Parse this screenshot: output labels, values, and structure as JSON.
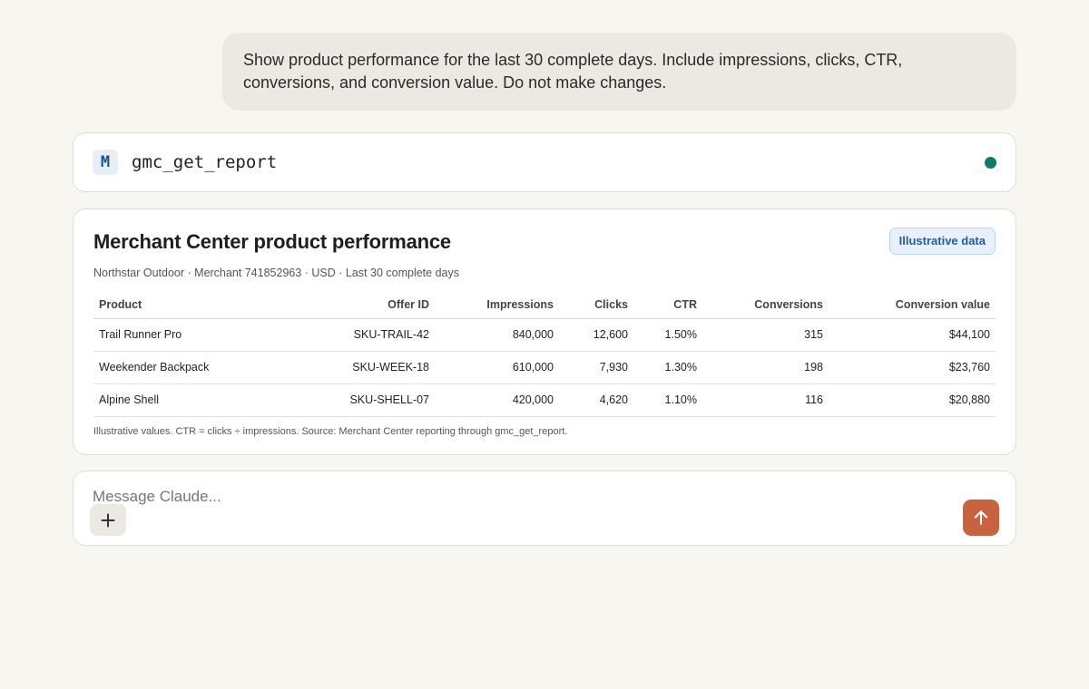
{
  "conversation": {
    "user_message": "Show product performance for the last 30 complete days. Include impressions, clicks, CTR, conversions, and conversion value. Do not make changes."
  },
  "tool_call": {
    "icon_letter": "M",
    "name": "gmc_get_report",
    "status_color": "#127a6a"
  },
  "report": {
    "title": "Merchant Center product performance",
    "badge": "Illustrative data",
    "subtitle": "Northstar Outdoor · Merchant 741852963 · USD · Last 30 complete days",
    "columns": [
      "Product",
      "Offer ID",
      "Impressions",
      "Clicks",
      "CTR",
      "Conversions",
      "Conversion value"
    ],
    "rows": [
      [
        "Trail Runner Pro",
        "SKU-TRAIL-42",
        "840,000",
        "12,600",
        "1.50%",
        "315",
        "$44,100"
      ],
      [
        "Weekender Backpack",
        "SKU-WEEK-18",
        "610,000",
        "7,930",
        "1.30%",
        "198",
        "$23,760"
      ],
      [
        "Alpine Shell",
        "SKU-SHELL-07",
        "420,000",
        "4,620",
        "1.10%",
        "116",
        "$20,880"
      ]
    ],
    "footnote": "Illustrative values. CTR = clicks ÷ impressions. Source: Merchant Center reporting through gmc_get_report."
  },
  "composer": {
    "placeholder": "Message Claude...",
    "add_icon": "plus-icon",
    "send_icon": "arrow-up-icon",
    "send_color": "#c9623f"
  }
}
